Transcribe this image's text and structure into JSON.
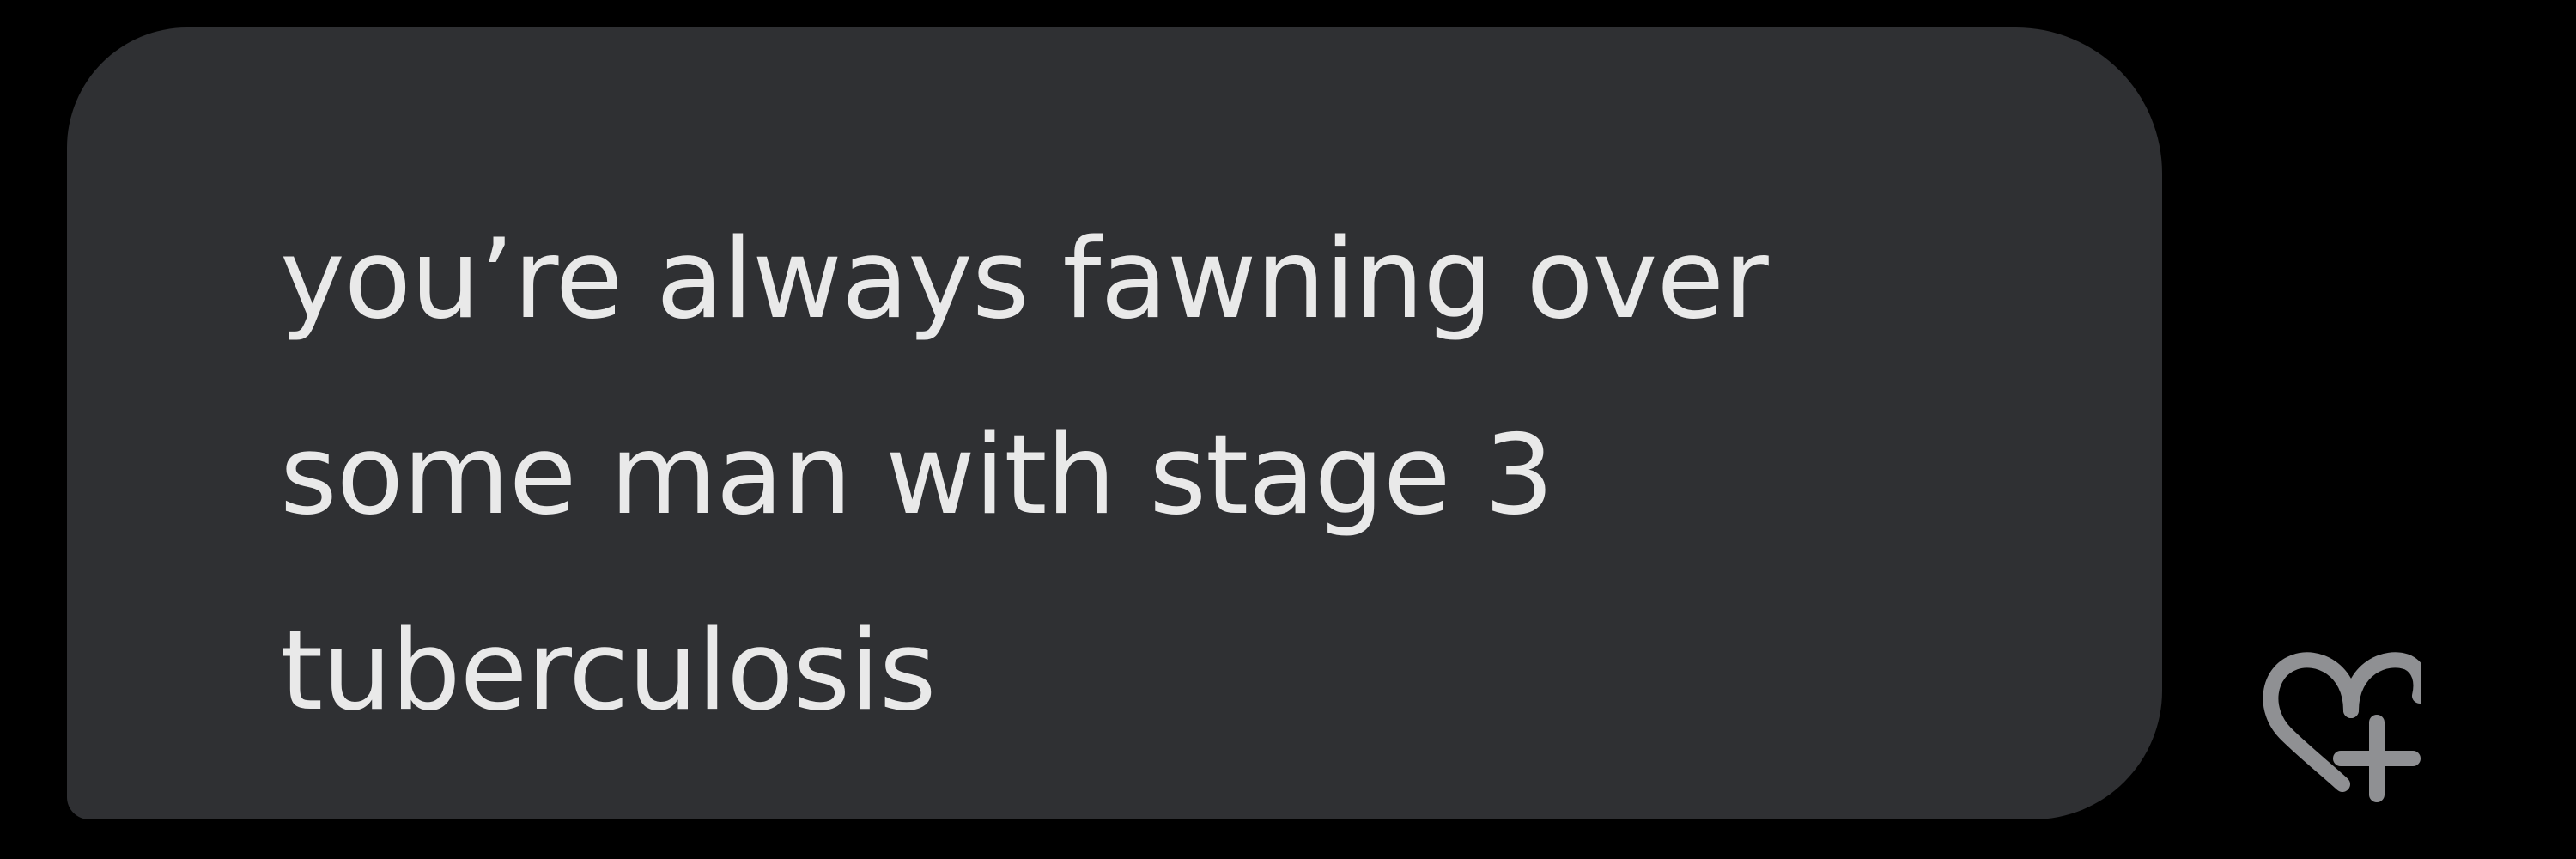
{
  "message": {
    "lines": [
      "you’re always fawning over",
      "some man with stage 3",
      "tuberculosis"
    ]
  },
  "reaction": {
    "icon": "heart-plus-icon",
    "icon_color": "#8f9093"
  },
  "colors": {
    "background": "#000000",
    "bubble": "#2f3033",
    "text": "#e9e9e9"
  }
}
